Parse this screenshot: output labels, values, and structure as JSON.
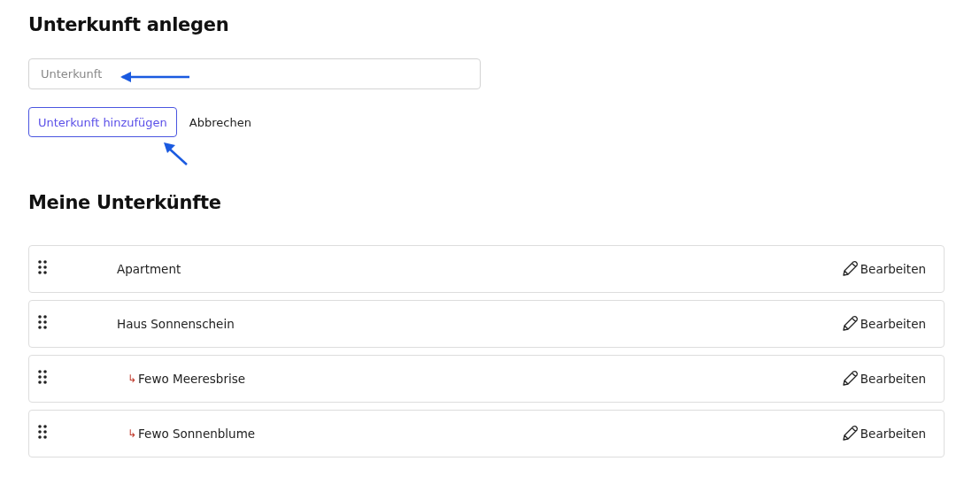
{
  "create_heading": "Unterkunft anlegen",
  "name_field": {
    "placeholder": "Unterkunft"
  },
  "add_button": "Unterkunft hinzufügen",
  "cancel_link": "Abbrechen",
  "list_heading": "Meine Unterkünfte",
  "accommodations": [
    {
      "name": "Apartment",
      "edit": "Bearbeiten"
    },
    {
      "name": "Haus Sonnenschein",
      "edit": "Bearbeiten",
      "children": [
        {
          "marker": "↳",
          "name": "Fewo Meeresbrise",
          "edit": "Bearbeiten"
        },
        {
          "marker": "↳",
          "name": "Fewo Sonnenblume",
          "edit": "Bearbeiten"
        }
      ]
    }
  ]
}
